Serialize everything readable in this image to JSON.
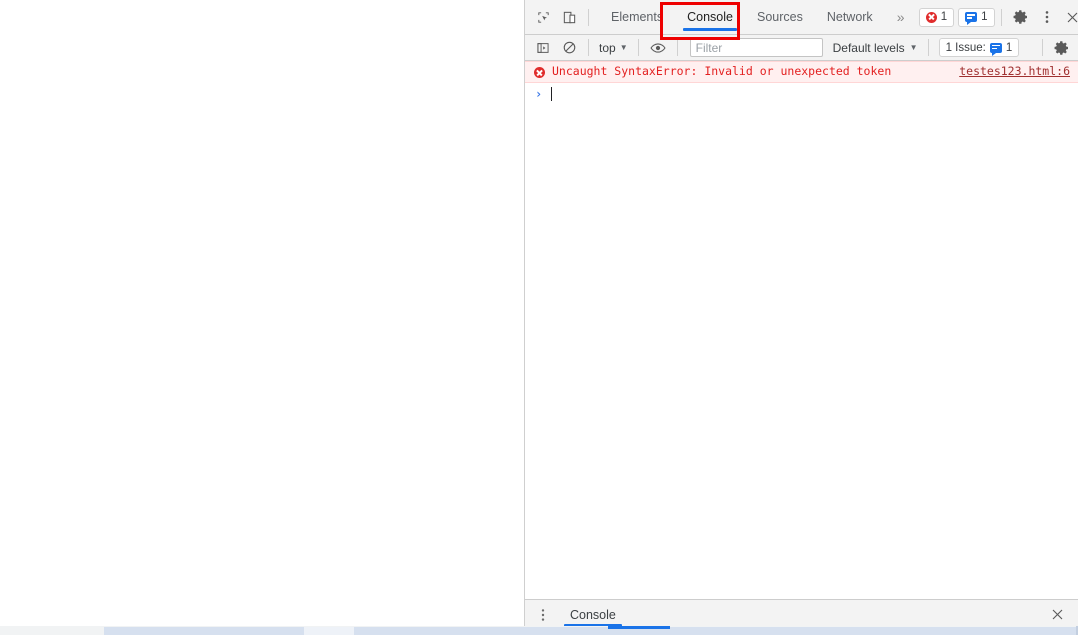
{
  "devtools": {
    "tabstrip": {
      "inspect_icon": "inspect-element-icon",
      "device_icon": "device-toolbar-icon",
      "tabs": [
        {
          "label": "Elements",
          "selected": false
        },
        {
          "label": "Console",
          "selected": true
        },
        {
          "label": "Sources",
          "selected": false
        },
        {
          "label": "Network",
          "selected": false
        }
      ],
      "more_tabs_label": "»",
      "error_badge": {
        "icon": "error-circle-icon",
        "count": "1"
      },
      "message_badge": {
        "icon": "message-bubble-icon",
        "count": "1"
      },
      "settings_icon": "gear-icon",
      "kebab_icon": "more-vertical-icon",
      "close_icon": "close-icon"
    },
    "console_toolbar": {
      "sidebar_toggle_icon": "console-sidebar-icon",
      "clear_icon": "clear-console-icon",
      "context_label": "top",
      "context_caret": "▼",
      "eye_icon": "live-expression-eye-icon",
      "filter_placeholder": "Filter",
      "filter_value": "",
      "levels_label": "Default levels",
      "levels_caret": "▼",
      "issues_label": "1 Issue:",
      "issues_count": "1",
      "settings_icon": "gear-icon"
    },
    "console_body": {
      "error_icon": "error-circle-icon",
      "error_message": "Uncaught SyntaxError: Invalid or unexpected token",
      "error_source": "testes123.html:6",
      "prompt_symbol": "›",
      "prompt_value": ""
    },
    "drawer": {
      "kebab_icon": "more-vertical-icon",
      "tabs": [
        {
          "label": "Console",
          "selected": true
        }
      ],
      "close_icon": "close-icon"
    }
  },
  "annotation": {
    "type": "red-rectangle-highlight",
    "target": "Console",
    "color": "#ee0000"
  },
  "colors": {
    "accent": "#1a73e8",
    "error_text": "#e32020",
    "error_row_bg": "#fff0f0",
    "toolbar_bg": "#f3f3f3",
    "annotation": "#ee0000"
  }
}
